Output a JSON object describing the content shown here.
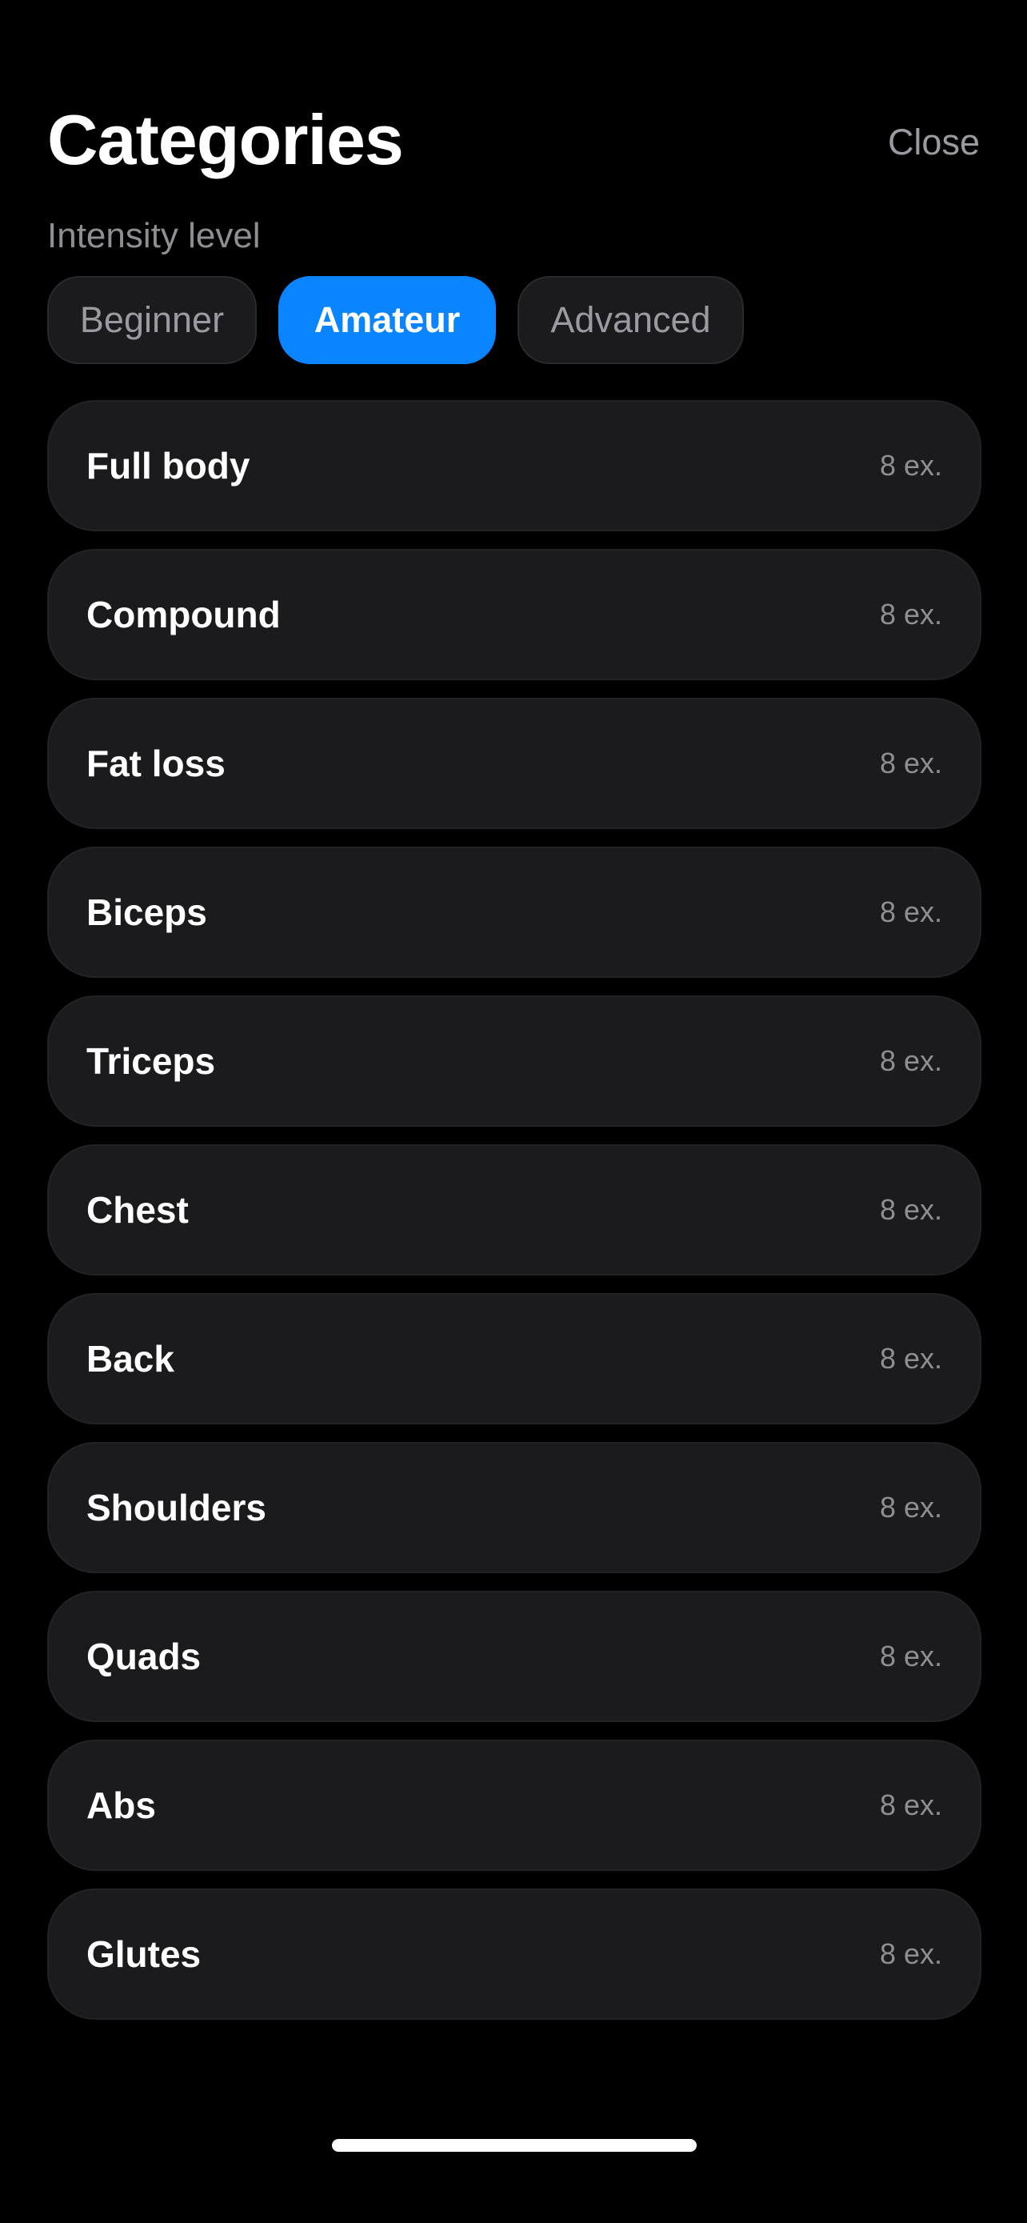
{
  "header": {
    "title": "Categories",
    "close_label": "Close"
  },
  "intensity": {
    "label": "Intensity level",
    "options": [
      {
        "label": "Beginner",
        "selected": false
      },
      {
        "label": "Amateur",
        "selected": true
      },
      {
        "label": "Advanced",
        "selected": false
      }
    ]
  },
  "categories": [
    {
      "name": "Full body",
      "count": "8 ex."
    },
    {
      "name": "Compound",
      "count": "8 ex."
    },
    {
      "name": "Fat loss",
      "count": "8 ex."
    },
    {
      "name": "Biceps",
      "count": "8 ex."
    },
    {
      "name": "Triceps",
      "count": "8 ex."
    },
    {
      "name": "Chest",
      "count": "8 ex."
    },
    {
      "name": "Back",
      "count": "8 ex."
    },
    {
      "name": "Shoulders",
      "count": "8 ex."
    },
    {
      "name": "Quads",
      "count": "8 ex."
    },
    {
      "name": "Abs",
      "count": "8 ex."
    },
    {
      "name": "Glutes",
      "count": "8 ex."
    }
  ],
  "colors": {
    "background": "#000000",
    "card": "#1b1b1e",
    "accent": "#0a84ff",
    "secondary_text": "#8e8e93"
  }
}
